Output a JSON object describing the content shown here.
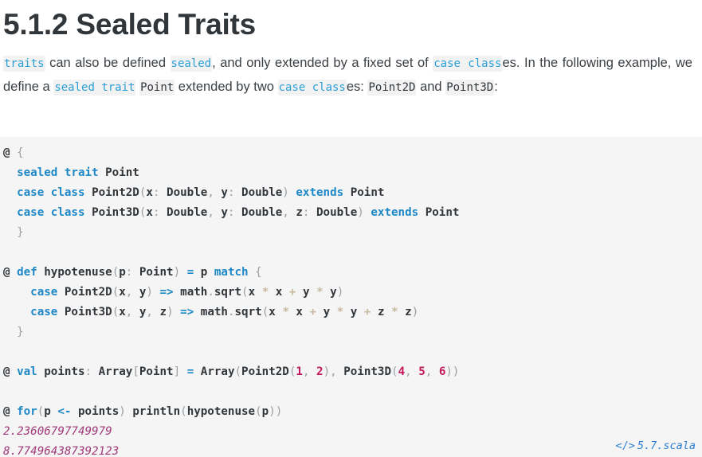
{
  "document": {
    "heading": "5.1.2 Sealed Traits",
    "paragraph": {
      "segments": [
        {
          "type": "code",
          "text": "traits",
          "keyword": true
        },
        {
          "type": "text",
          "text": " can also be defined "
        },
        {
          "type": "code",
          "text": "sealed",
          "keyword": true
        },
        {
          "type": "text",
          "text": ", and only extended by a fixed set of "
        },
        {
          "type": "code",
          "text": "case class",
          "keyword": true
        },
        {
          "type": "text",
          "text": "es. In the following example, we define a "
        },
        {
          "type": "code",
          "text": "sealed trait",
          "keyword": true
        },
        {
          "type": "text",
          "text": " "
        },
        {
          "type": "code",
          "text": "Point",
          "keyword": false
        },
        {
          "type": "text",
          "text": " extended by two "
        },
        {
          "type": "code",
          "text": "case class",
          "keyword": true
        },
        {
          "type": "text",
          "text": "es: "
        },
        {
          "type": "code",
          "text": "Point2D",
          "keyword": false
        },
        {
          "type": "text",
          "text": " and "
        },
        {
          "type": "code",
          "text": "Point3D",
          "keyword": false
        },
        {
          "type": "text",
          "text": ":"
        }
      ]
    }
  },
  "code_block": {
    "language": "scala",
    "lines": [
      {
        "id": "line-1",
        "tokens": [
          {
            "c": "prompt",
            "t": "@"
          },
          {
            "c": "plain",
            "t": " "
          },
          {
            "c": "punct",
            "t": "{"
          }
        ]
      },
      {
        "id": "line-2",
        "tokens": [
          {
            "c": "plain",
            "t": "  "
          },
          {
            "c": "kw",
            "t": "sealed trait"
          },
          {
            "c": "plain",
            "t": " "
          },
          {
            "c": "type",
            "t": "Point"
          }
        ]
      },
      {
        "id": "line-3",
        "tokens": [
          {
            "c": "plain",
            "t": "  "
          },
          {
            "c": "kw",
            "t": "case class"
          },
          {
            "c": "plain",
            "t": " "
          },
          {
            "c": "type",
            "t": "Point2D"
          },
          {
            "c": "punct",
            "t": "("
          },
          {
            "c": "id",
            "t": "x"
          },
          {
            "c": "punct",
            "t": ":"
          },
          {
            "c": "plain",
            "t": " "
          },
          {
            "c": "type",
            "t": "Double"
          },
          {
            "c": "punct",
            "t": ","
          },
          {
            "c": "plain",
            "t": " "
          },
          {
            "c": "id",
            "t": "y"
          },
          {
            "c": "punct",
            "t": ":"
          },
          {
            "c": "plain",
            "t": " "
          },
          {
            "c": "type",
            "t": "Double"
          },
          {
            "c": "punct",
            "t": ")"
          },
          {
            "c": "plain",
            "t": " "
          },
          {
            "c": "kw",
            "t": "extends"
          },
          {
            "c": "plain",
            "t": " "
          },
          {
            "c": "type",
            "t": "Point"
          }
        ]
      },
      {
        "id": "line-4",
        "tokens": [
          {
            "c": "plain",
            "t": "  "
          },
          {
            "c": "kw",
            "t": "case class"
          },
          {
            "c": "plain",
            "t": " "
          },
          {
            "c": "type",
            "t": "Point3D"
          },
          {
            "c": "punct",
            "t": "("
          },
          {
            "c": "id",
            "t": "x"
          },
          {
            "c": "punct",
            "t": ":"
          },
          {
            "c": "plain",
            "t": " "
          },
          {
            "c": "type",
            "t": "Double"
          },
          {
            "c": "punct",
            "t": ","
          },
          {
            "c": "plain",
            "t": " "
          },
          {
            "c": "id",
            "t": "y"
          },
          {
            "c": "punct",
            "t": ":"
          },
          {
            "c": "plain",
            "t": " "
          },
          {
            "c": "type",
            "t": "Double"
          },
          {
            "c": "punct",
            "t": ","
          },
          {
            "c": "plain",
            "t": " "
          },
          {
            "c": "id",
            "t": "z"
          },
          {
            "c": "punct",
            "t": ":"
          },
          {
            "c": "plain",
            "t": " "
          },
          {
            "c": "type",
            "t": "Double"
          },
          {
            "c": "punct",
            "t": ")"
          },
          {
            "c": "plain",
            "t": " "
          },
          {
            "c": "kw",
            "t": "extends"
          },
          {
            "c": "plain",
            "t": " "
          },
          {
            "c": "type",
            "t": "Point"
          }
        ]
      },
      {
        "id": "line-5",
        "tokens": [
          {
            "c": "plain",
            "t": "  "
          },
          {
            "c": "punct",
            "t": "}"
          }
        ]
      },
      {
        "id": "line-6",
        "tokens": []
      },
      {
        "id": "line-7",
        "tokens": [
          {
            "c": "prompt",
            "t": "@"
          },
          {
            "c": "plain",
            "t": " "
          },
          {
            "c": "kw",
            "t": "def"
          },
          {
            "c": "plain",
            "t": " "
          },
          {
            "c": "id",
            "t": "hypotenuse"
          },
          {
            "c": "punct",
            "t": "("
          },
          {
            "c": "id",
            "t": "p"
          },
          {
            "c": "punct",
            "t": ":"
          },
          {
            "c": "plain",
            "t": " "
          },
          {
            "c": "type",
            "t": "Point"
          },
          {
            "c": "punct",
            "t": ")"
          },
          {
            "c": "plain",
            "t": " "
          },
          {
            "c": "op",
            "t": "="
          },
          {
            "c": "plain",
            "t": " "
          },
          {
            "c": "id",
            "t": "p"
          },
          {
            "c": "plain",
            "t": " "
          },
          {
            "c": "kw",
            "t": "match"
          },
          {
            "c": "plain",
            "t": " "
          },
          {
            "c": "punct",
            "t": "{"
          }
        ]
      },
      {
        "id": "line-8",
        "tokens": [
          {
            "c": "plain",
            "t": "    "
          },
          {
            "c": "kw",
            "t": "case"
          },
          {
            "c": "plain",
            "t": " "
          },
          {
            "c": "type",
            "t": "Point2D"
          },
          {
            "c": "punct",
            "t": "("
          },
          {
            "c": "id",
            "t": "x"
          },
          {
            "c": "punct",
            "t": ","
          },
          {
            "c": "plain",
            "t": " "
          },
          {
            "c": "id",
            "t": "y"
          },
          {
            "c": "punct",
            "t": ")"
          },
          {
            "c": "plain",
            "t": " "
          },
          {
            "c": "op",
            "t": "=>"
          },
          {
            "c": "plain",
            "t": " "
          },
          {
            "c": "id",
            "t": "math"
          },
          {
            "c": "punct",
            "t": "."
          },
          {
            "c": "id",
            "t": "sqrt"
          },
          {
            "c": "punct",
            "t": "("
          },
          {
            "c": "id",
            "t": "x"
          },
          {
            "c": "plain",
            "t": " "
          },
          {
            "c": "arith",
            "t": "*"
          },
          {
            "c": "plain",
            "t": " "
          },
          {
            "c": "id",
            "t": "x"
          },
          {
            "c": "plain",
            "t": " "
          },
          {
            "c": "arith",
            "t": "+"
          },
          {
            "c": "plain",
            "t": " "
          },
          {
            "c": "id",
            "t": "y"
          },
          {
            "c": "plain",
            "t": " "
          },
          {
            "c": "arith",
            "t": "*"
          },
          {
            "c": "plain",
            "t": " "
          },
          {
            "c": "id",
            "t": "y"
          },
          {
            "c": "punct",
            "t": ")"
          }
        ]
      },
      {
        "id": "line-9",
        "tokens": [
          {
            "c": "plain",
            "t": "    "
          },
          {
            "c": "kw",
            "t": "case"
          },
          {
            "c": "plain",
            "t": " "
          },
          {
            "c": "type",
            "t": "Point3D"
          },
          {
            "c": "punct",
            "t": "("
          },
          {
            "c": "id",
            "t": "x"
          },
          {
            "c": "punct",
            "t": ","
          },
          {
            "c": "plain",
            "t": " "
          },
          {
            "c": "id",
            "t": "y"
          },
          {
            "c": "punct",
            "t": ","
          },
          {
            "c": "plain",
            "t": " "
          },
          {
            "c": "id",
            "t": "z"
          },
          {
            "c": "punct",
            "t": ")"
          },
          {
            "c": "plain",
            "t": " "
          },
          {
            "c": "op",
            "t": "=>"
          },
          {
            "c": "plain",
            "t": " "
          },
          {
            "c": "id",
            "t": "math"
          },
          {
            "c": "punct",
            "t": "."
          },
          {
            "c": "id",
            "t": "sqrt"
          },
          {
            "c": "punct",
            "t": "("
          },
          {
            "c": "id",
            "t": "x"
          },
          {
            "c": "plain",
            "t": " "
          },
          {
            "c": "arith",
            "t": "*"
          },
          {
            "c": "plain",
            "t": " "
          },
          {
            "c": "id",
            "t": "x"
          },
          {
            "c": "plain",
            "t": " "
          },
          {
            "c": "arith",
            "t": "+"
          },
          {
            "c": "plain",
            "t": " "
          },
          {
            "c": "id",
            "t": "y"
          },
          {
            "c": "plain",
            "t": " "
          },
          {
            "c": "arith",
            "t": "*"
          },
          {
            "c": "plain",
            "t": " "
          },
          {
            "c": "id",
            "t": "y"
          },
          {
            "c": "plain",
            "t": " "
          },
          {
            "c": "arith",
            "t": "+"
          },
          {
            "c": "plain",
            "t": " "
          },
          {
            "c": "id",
            "t": "z"
          },
          {
            "c": "plain",
            "t": " "
          },
          {
            "c": "arith",
            "t": "*"
          },
          {
            "c": "plain",
            "t": " "
          },
          {
            "c": "id",
            "t": "z"
          },
          {
            "c": "punct",
            "t": ")"
          }
        ]
      },
      {
        "id": "line-10",
        "tokens": [
          {
            "c": "plain",
            "t": "  "
          },
          {
            "c": "punct",
            "t": "}"
          }
        ]
      },
      {
        "id": "line-11",
        "tokens": []
      },
      {
        "id": "line-12",
        "tokens": [
          {
            "c": "prompt",
            "t": "@"
          },
          {
            "c": "plain",
            "t": " "
          },
          {
            "c": "kw",
            "t": "val"
          },
          {
            "c": "plain",
            "t": " "
          },
          {
            "c": "id",
            "t": "points"
          },
          {
            "c": "punct",
            "t": ":"
          },
          {
            "c": "plain",
            "t": " "
          },
          {
            "c": "type",
            "t": "Array"
          },
          {
            "c": "punct",
            "t": "["
          },
          {
            "c": "type",
            "t": "Point"
          },
          {
            "c": "punct",
            "t": "]"
          },
          {
            "c": "plain",
            "t": " "
          },
          {
            "c": "op",
            "t": "="
          },
          {
            "c": "plain",
            "t": " "
          },
          {
            "c": "type",
            "t": "Array"
          },
          {
            "c": "punct",
            "t": "("
          },
          {
            "c": "type",
            "t": "Point2D"
          },
          {
            "c": "punct",
            "t": "("
          },
          {
            "c": "num",
            "t": "1"
          },
          {
            "c": "punct",
            "t": ","
          },
          {
            "c": "plain",
            "t": " "
          },
          {
            "c": "num",
            "t": "2"
          },
          {
            "c": "punct",
            "t": "),"
          },
          {
            "c": "plain",
            "t": " "
          },
          {
            "c": "type",
            "t": "Point3D"
          },
          {
            "c": "punct",
            "t": "("
          },
          {
            "c": "num",
            "t": "4"
          },
          {
            "c": "punct",
            "t": ","
          },
          {
            "c": "plain",
            "t": " "
          },
          {
            "c": "num",
            "t": "5"
          },
          {
            "c": "punct",
            "t": ","
          },
          {
            "c": "plain",
            "t": " "
          },
          {
            "c": "num",
            "t": "6"
          },
          {
            "c": "punct",
            "t": "))"
          }
        ]
      },
      {
        "id": "line-13",
        "tokens": []
      },
      {
        "id": "line-14",
        "tokens": [
          {
            "c": "prompt",
            "t": "@"
          },
          {
            "c": "plain",
            "t": " "
          },
          {
            "c": "kw",
            "t": "for"
          },
          {
            "c": "punct",
            "t": "("
          },
          {
            "c": "id",
            "t": "p"
          },
          {
            "c": "plain",
            "t": " "
          },
          {
            "c": "op",
            "t": "<-"
          },
          {
            "c": "plain",
            "t": " "
          },
          {
            "c": "id",
            "t": "points"
          },
          {
            "c": "punct",
            "t": ")"
          },
          {
            "c": "plain",
            "t": " "
          },
          {
            "c": "id",
            "t": "println"
          },
          {
            "c": "punct",
            "t": "("
          },
          {
            "c": "id",
            "t": "hypotenuse"
          },
          {
            "c": "punct",
            "t": "("
          },
          {
            "c": "id",
            "t": "p"
          },
          {
            "c": "punct",
            "t": "))"
          }
        ]
      },
      {
        "id": "line-15",
        "tokens": [
          {
            "c": "out",
            "t": "2.23606797749979"
          }
        ]
      },
      {
        "id": "line-16",
        "tokens": [
          {
            "c": "out",
            "t": "8.774964387392123"
          }
        ]
      }
    ]
  },
  "file_badge": {
    "glyph": "</>",
    "filename": "5.7.scala"
  }
}
